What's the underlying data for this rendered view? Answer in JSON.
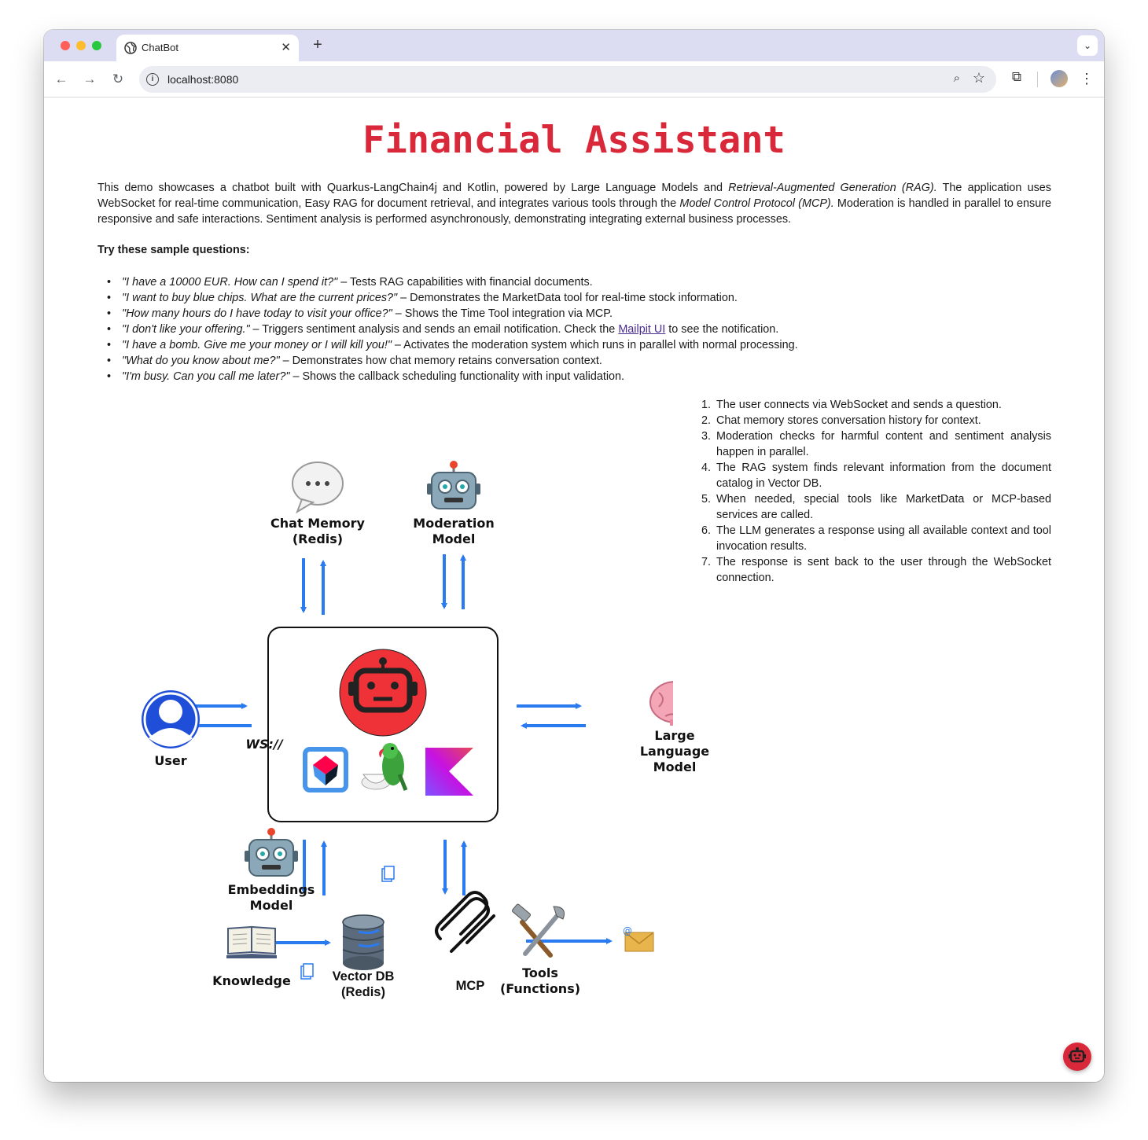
{
  "browser": {
    "tab_title": "ChatBot",
    "url": "localhost:8080"
  },
  "page": {
    "title": "Financial Assistant",
    "intro_p1": "This demo showcases a chatbot built with Quarkus-LangChain4j and Kotlin, powered by Large Language Models and ",
    "intro_em1": "Retrieval-Augmented Generation (RAG).",
    "intro_p2": " The application uses WebSocket for real-time communication, Easy RAG for document retrieval, and integrates various tools through the ",
    "intro_em2": "Model Control Protocol (MCP).",
    "intro_p3": " Moderation is handled in parallel to ensure responsive and safe interactions. Sentiment analysis is performed asynchronously, demonstrating integrating external business processes.",
    "try_label": "Try these sample questions:",
    "questions": [
      {
        "q": "\"I have a 10000 EUR. How can I spend it?\"",
        "desc": " – Tests RAG capabilities with financial documents."
      },
      {
        "q": "\"I want to buy blue chips. What are the current prices?\"",
        "desc": " – Demonstrates the MarketData tool for real-time stock information."
      },
      {
        "q": "\"How many hours do I have today to visit your office?\"",
        "desc": " – Shows the Time Tool integration via MCP."
      },
      {
        "q": "\"I don't like your offering.\"",
        "desc": " – Triggers sentiment analysis and sends an email notification. Check the ",
        "link": "Mailpit UI",
        "desc2": " to see the notification."
      },
      {
        "q": "\"I have a bomb. Give me your money or I will kill you!\"",
        "desc": " – Activates the moderation system which runs in parallel with normal processing."
      },
      {
        "q": "\"What do you know about me?\"",
        "desc": " – Demonstrates how chat memory retains conversation context."
      },
      {
        "q": "\"I'm busy. Can you call me later?\"",
        "desc": " – Shows the callback scheduling functionality with input validation."
      }
    ],
    "steps": [
      "The user connects via WebSocket and sends a question.",
      "Chat memory stores conversation history for context.",
      "Moderation checks for harmful content and sentiment analysis happen in parallel.",
      "The RAG system finds relevant information from the document catalog in Vector DB.",
      "When needed, special tools like MarketData or MCP-based services are called.",
      "The LLM generates a response using all available context and tool invocation results.",
      "The response is sent back to the user through the WebSocket connection."
    ]
  },
  "diagram": {
    "chat_memory_l1": "Chat Memory",
    "chat_memory_l2": "(Redis)",
    "moderation_l1": "Moderation",
    "moderation_l2": "Model",
    "user": "User",
    "ws": "WS://",
    "llm_l1": "Large",
    "llm_l2": "Language",
    "llm_l3": "Model",
    "embeddings_l1": "Embeddings",
    "embeddings_l2": "Model",
    "knowledge": "Knowledge",
    "vectordb_l1": "Vector DB",
    "vectordb_l2": "(Redis)",
    "mcp": "MCP",
    "tools_l1": "Tools",
    "tools_l2": "(Functions)"
  },
  "colors": {
    "title": "#d9283a",
    "arrow": "#2b7bf0",
    "link": "#4b2c8f",
    "user_icon": "#1f4fd8"
  },
  "icons": [
    "globe-icon",
    "close-icon",
    "plus-icon",
    "back-icon",
    "forward-icon",
    "reload-icon",
    "info-icon",
    "zoom-icon",
    "star-icon",
    "extensions-icon",
    "avatar",
    "menu-icon",
    "speech-bubble-icon",
    "robot-icon",
    "brain-icon",
    "book-icon",
    "database-icon",
    "document-icon",
    "mcp-icon",
    "tools-icon",
    "envelope-icon"
  ]
}
